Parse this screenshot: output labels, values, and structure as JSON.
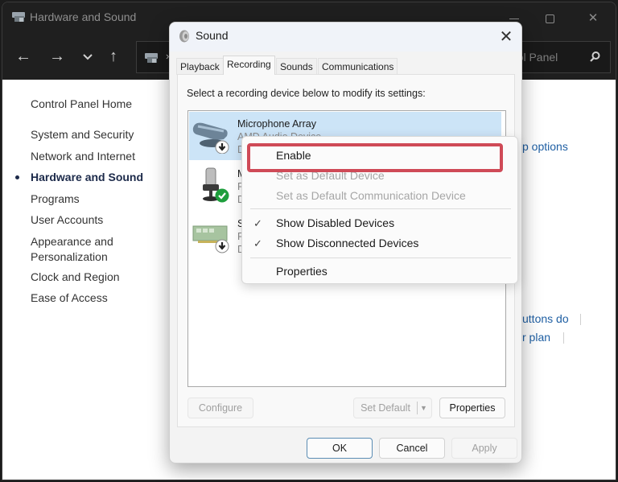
{
  "control_panel": {
    "window_title": "Hardware and Sound",
    "window_controls": {
      "minimize": "minimize",
      "maximize": "maximize",
      "close": "✕"
    },
    "nav": {
      "back": "←",
      "forward": "→",
      "recent": "⌄",
      "up": "↑",
      "address_separator": "›",
      "search_placeholder": "Search Control Panel",
      "search_visible_text": "rol Panel"
    },
    "sidebar": {
      "home": "Control Panel Home",
      "items": [
        {
          "label": "System and Security",
          "active": false
        },
        {
          "label": "Network and Internet",
          "active": false
        },
        {
          "label": "Hardware and Sound",
          "active": true
        },
        {
          "label": "Programs",
          "active": false
        },
        {
          "label": "User Accounts",
          "active": false
        },
        {
          "label": "Appearance and\nPersonalization",
          "active": false
        },
        {
          "label": "Clock and Region",
          "active": false
        },
        {
          "label": "Ease of Access",
          "active": false
        }
      ]
    },
    "content_links_partial": [
      "p options",
      "uttons do",
      "r plan"
    ]
  },
  "sound_dialog": {
    "title": "Sound",
    "close": "✕",
    "tabs": [
      {
        "label": "Playback",
        "active": false
      },
      {
        "label": "Recording",
        "active": true
      },
      {
        "label": "Sounds",
        "active": false
      },
      {
        "label": "Communications",
        "active": false
      }
    ],
    "instruction": "Select a recording device below to modify its settings:",
    "devices": [
      {
        "name": "Microphone Array",
        "sub": "AMD Audio Device",
        "status": "D",
        "icon": "microphone-array-icon",
        "badge": "disabled-arrow",
        "selected": true
      },
      {
        "name": "M",
        "sub": "R",
        "status": "D",
        "icon": "microphone-icon",
        "badge": "default-check",
        "selected": false
      },
      {
        "name": "S",
        "sub": "R",
        "status": "D",
        "icon": "sound-card-icon",
        "badge": "disabled-arrow",
        "selected": false
      }
    ],
    "buttons": {
      "configure": "Configure",
      "set_default": "Set Default",
      "properties": "Properties",
      "ok": "OK",
      "cancel": "Cancel",
      "apply": "Apply"
    }
  },
  "context_menu": {
    "items": [
      {
        "label": "Enable",
        "enabled": true,
        "checked": false,
        "highlighted": true
      },
      {
        "label": "Set as Default Device",
        "enabled": false,
        "checked": false
      },
      {
        "label": "Set as Default Communication Device",
        "enabled": false,
        "checked": false
      },
      {
        "label": "Show Disabled Devices",
        "enabled": true,
        "checked": true
      },
      {
        "label": "Show Disconnected Devices",
        "enabled": true,
        "checked": true
      },
      {
        "label": "Properties",
        "enabled": true,
        "checked": false
      }
    ],
    "check_glyph": "✓"
  },
  "colors": {
    "highlight_outline": "#cf4a57",
    "selected_row": "#cce4f7",
    "link": "#1f5fa3",
    "default_badge": "#1e9e3c"
  }
}
